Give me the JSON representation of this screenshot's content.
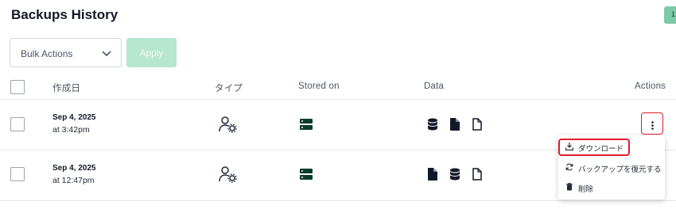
{
  "page": {
    "title": "Backups History",
    "badge": "1"
  },
  "toolbar": {
    "bulk_placeholder": "Bulk Actions",
    "apply_label": "Apply"
  },
  "table": {
    "headers": {
      "date": "作成日",
      "type": "タイプ",
      "stored": "Stored on",
      "data": "Data",
      "actions": "Actions"
    },
    "rows": [
      {
        "date": "Sep 4, 2025",
        "time": "at 3:42pm",
        "data_icons": [
          "database-icon",
          "file-filled-icon",
          "file-outline-icon"
        ]
      },
      {
        "date": "Sep 4, 2025",
        "time": "at 12:47pm",
        "data_icons": [
          "file-filled-icon",
          "database-icon",
          "file-outline-icon"
        ]
      }
    ]
  },
  "menu": {
    "items": [
      {
        "label": "ダウンロード",
        "icon": "download-icon"
      },
      {
        "label": "バックアップを復元する",
        "icon": "restore-icon"
      },
      {
        "label": "削除",
        "icon": "trash-icon"
      }
    ]
  },
  "colors": {
    "accent": "#7dcaa8",
    "apply_bg": "#b7e6cf",
    "highlight": "#e11d2e",
    "server": "#0b3d2e"
  }
}
